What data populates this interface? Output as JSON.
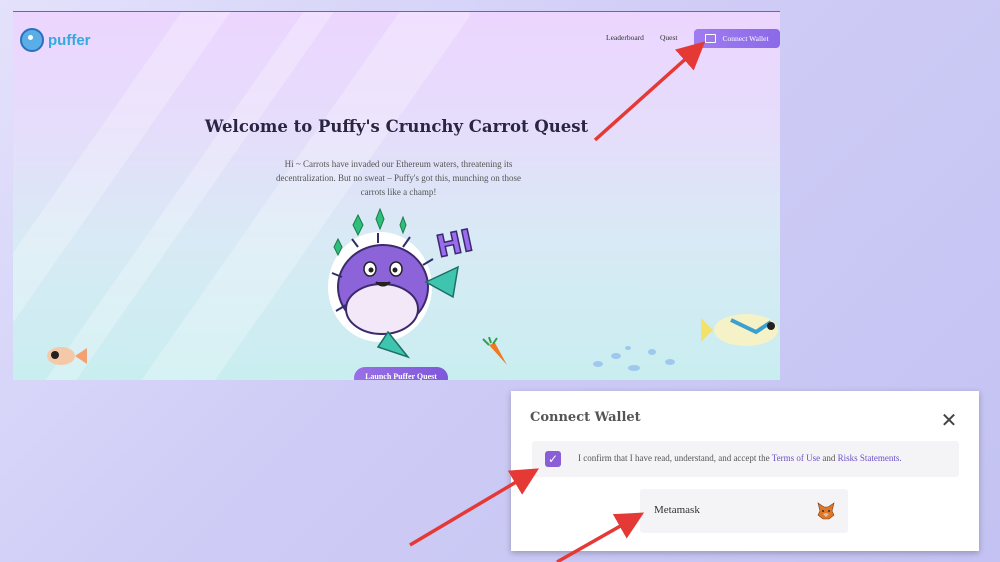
{
  "nav": {
    "logo": "puffer",
    "leaderboard": "Leaderboard",
    "quest": "Quest",
    "connect_wallet": "Connect Wallet"
  },
  "hero": {
    "title": "Welcome to Puffy's Crunchy Carrot Quest",
    "desc_line1": "Hi ~ Carrots have invaded our Ethereum waters, threatening its",
    "desc_line2": "decentralization. But no sweat – Puffy's got this, munching on those",
    "desc_line3": "carrots like a champ!",
    "launch_button": "Launch Puffer Quest",
    "sticker_text": "HI"
  },
  "modal": {
    "title": "Connect Wallet",
    "confirm_prefix": "I confirm that I have read, understand, and accept the",
    "terms_link": "Terms of Use",
    "and_text": "and",
    "risks_link": "Risks Statements.",
    "wallet_option": "Metamask",
    "checked": true
  },
  "colors": {
    "accent": "#8a5ed6",
    "annotation_arrow": "#e53935"
  }
}
